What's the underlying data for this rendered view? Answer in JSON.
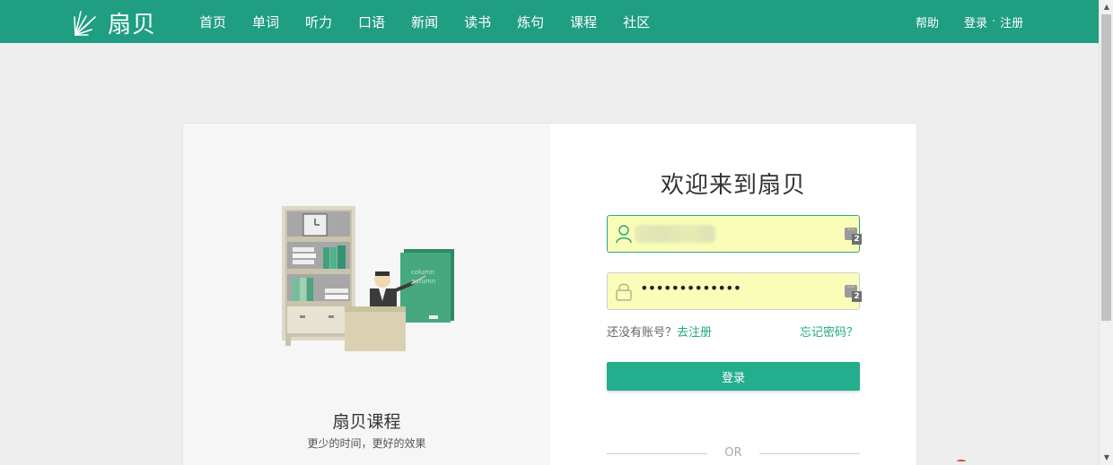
{
  "brand": {
    "name": "扇贝",
    "color": "#1f9e82"
  },
  "nav": {
    "items": [
      "首页",
      "单词",
      "听力",
      "口语",
      "新闻",
      "读书",
      "炼句",
      "课程",
      "社区"
    ]
  },
  "header_right": {
    "help": "帮助",
    "login": "登录",
    "separator": "·",
    "register": "注册"
  },
  "promo": {
    "chalkboard_text_1": "column",
    "chalkboard_text_2": "autumn",
    "title": "扇贝课程",
    "subtitle": "更少的时间，更好的效果"
  },
  "login_form": {
    "welcome": "欢迎来到扇贝",
    "username_value": "",
    "password_value": "•••••••••••••",
    "password_manager_count": "2",
    "no_account": "还没有账号？",
    "go_register": "去注册",
    "forgot_password": "忘记密码？",
    "submit_label": "登录",
    "divider": "OR"
  },
  "icons": [
    "shanbay-logo-icon",
    "user-icon",
    "lock-icon",
    "password-manager-icon"
  ],
  "colors": {
    "accent": "#23ae8d",
    "field_bg": "#fafdb8",
    "page_bg": "#eeeeee"
  }
}
